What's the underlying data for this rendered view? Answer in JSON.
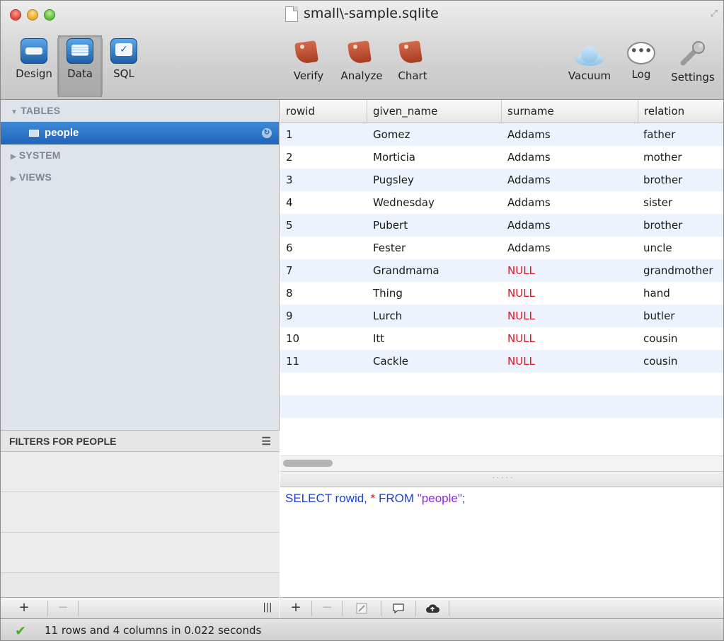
{
  "window": {
    "title": "small\\-sample.sqlite"
  },
  "toolbar": {
    "modes": [
      {
        "label": "Design",
        "icon": "design-icon",
        "active": false
      },
      {
        "label": "Data",
        "icon": "data-icon",
        "active": true
      },
      {
        "label": "SQL",
        "icon": "sql-icon",
        "active": false
      }
    ],
    "actions": [
      {
        "label": "Verify",
        "icon": "verify-icon"
      },
      {
        "label": "Analyze",
        "icon": "analyze-icon"
      },
      {
        "label": "Chart",
        "icon": "chart-icon"
      }
    ],
    "right": [
      {
        "label": "Vacuum",
        "icon": "vacuum-cloud-icon"
      },
      {
        "label": "Log",
        "icon": "log-bubble-icon"
      },
      {
        "label": "Settings",
        "icon": "settings-wrench-icon"
      }
    ]
  },
  "sidebar": {
    "tables_header": "TABLES",
    "selected_table": "people",
    "system_header": "SYSTEM",
    "views_header": "VIEWS",
    "filters_header": "FILTERS FOR PEOPLE"
  },
  "table": {
    "columns": [
      "rowid",
      "given_name",
      "surname",
      "relation"
    ],
    "rows": [
      [
        "1",
        "Gomez",
        "Addams",
        "father"
      ],
      [
        "2",
        "Morticia",
        "Addams",
        "mother"
      ],
      [
        "3",
        "Pugsley",
        "Addams",
        "brother"
      ],
      [
        "4",
        "Wednesday",
        "Addams",
        "sister"
      ],
      [
        "5",
        "Pubert",
        "Addams",
        "brother"
      ],
      [
        "6",
        "Fester",
        "Addams",
        "uncle"
      ],
      [
        "7",
        "Grandmama",
        "NULL",
        "grandmother"
      ],
      [
        "8",
        "Thing",
        "NULL",
        "hand"
      ],
      [
        "9",
        "Lurch",
        "NULL",
        "butler"
      ],
      [
        "10",
        "Itt",
        "NULL",
        "cousin"
      ],
      [
        "11",
        "Cackle",
        "NULL",
        "cousin"
      ]
    ]
  },
  "sql": {
    "kw_select": "SELECT",
    "rest1": " rowid, ",
    "star": "*",
    "kw_from": " FROM ",
    "table": "\"people\"",
    "end": ";"
  },
  "bottom_toolbar": {
    "add": "+",
    "remove": "−",
    "columns": "|||"
  },
  "status": {
    "text": "11 rows and 4 columns in 0.022 seconds"
  },
  "colors": {
    "null": "#e8121f",
    "keyword": "#1d3fd8",
    "string": "#8a2be2",
    "selection": "#2a73c8"
  }
}
